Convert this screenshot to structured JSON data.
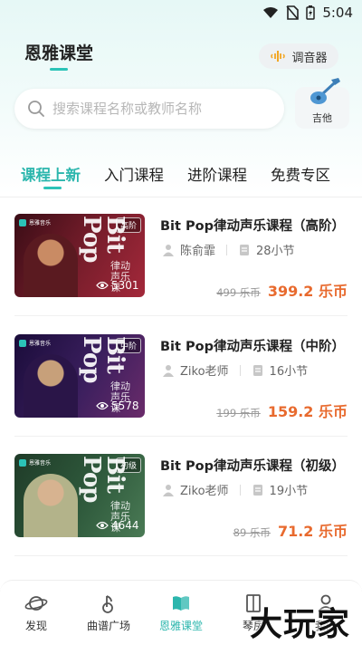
{
  "status_bar": {
    "time": "5:04"
  },
  "header": {
    "title": "恩雅课堂",
    "tuner_label": "调音器"
  },
  "search": {
    "placeholder": "搜索课程名称或教师名称"
  },
  "instrument": {
    "label": "吉他"
  },
  "tabs": [
    {
      "label": "课程上新",
      "active": true
    },
    {
      "label": "入门课程",
      "active": false
    },
    {
      "label": "进阶课程",
      "active": false
    },
    {
      "label": "免费专区",
      "active": false
    }
  ],
  "courses": [
    {
      "title": "Bit Pop律动声乐课程（高阶）",
      "teacher": "陈俞霏",
      "lessons": "28小节",
      "old_price": "499 乐币",
      "price": "399.2 乐币",
      "views": "5301",
      "level_badge": "高阶",
      "thumb_big": "Bit Pop",
      "thumb_sub": "律动声乐课",
      "brand": "恩雅音乐",
      "theme": "#7a1e2c"
    },
    {
      "title": "Bit Pop律动声乐课程（中阶）",
      "teacher": "Ziko老师",
      "lessons": "16小节",
      "old_price": "199 乐币",
      "price": "159.2 乐币",
      "views": "5578",
      "level_badge": "中阶",
      "thumb_big": "Bit Pop",
      "thumb_sub": "律动声乐课",
      "brand": "恩雅音乐",
      "theme": "#3b1f5e"
    },
    {
      "title": "Bit Pop律动声乐课程（初级）",
      "teacher": "Ziko老师",
      "lessons": "19小节",
      "old_price": "89 乐币",
      "price": "71.2 乐币",
      "views": "4644",
      "level_badge": "初级",
      "thumb_big": "Bit Pop",
      "thumb_sub": "律动声乐课",
      "brand": "恩雅音乐",
      "theme": "#2f5a3c"
    }
  ],
  "bottom_nav": [
    {
      "label": "发现",
      "icon": "planet-icon",
      "active": false
    },
    {
      "label": "曲谱广场",
      "icon": "music-note-icon",
      "active": false
    },
    {
      "label": "恩雅课堂",
      "icon": "book-icon",
      "active": true
    },
    {
      "label": "琴房",
      "icon": "door-icon",
      "active": false
    },
    {
      "label": "我的",
      "icon": "profile-icon",
      "active": false
    }
  ],
  "watermark": "大玩家",
  "colors": {
    "accent": "#2bb6ad",
    "price": "#e86a2e"
  }
}
